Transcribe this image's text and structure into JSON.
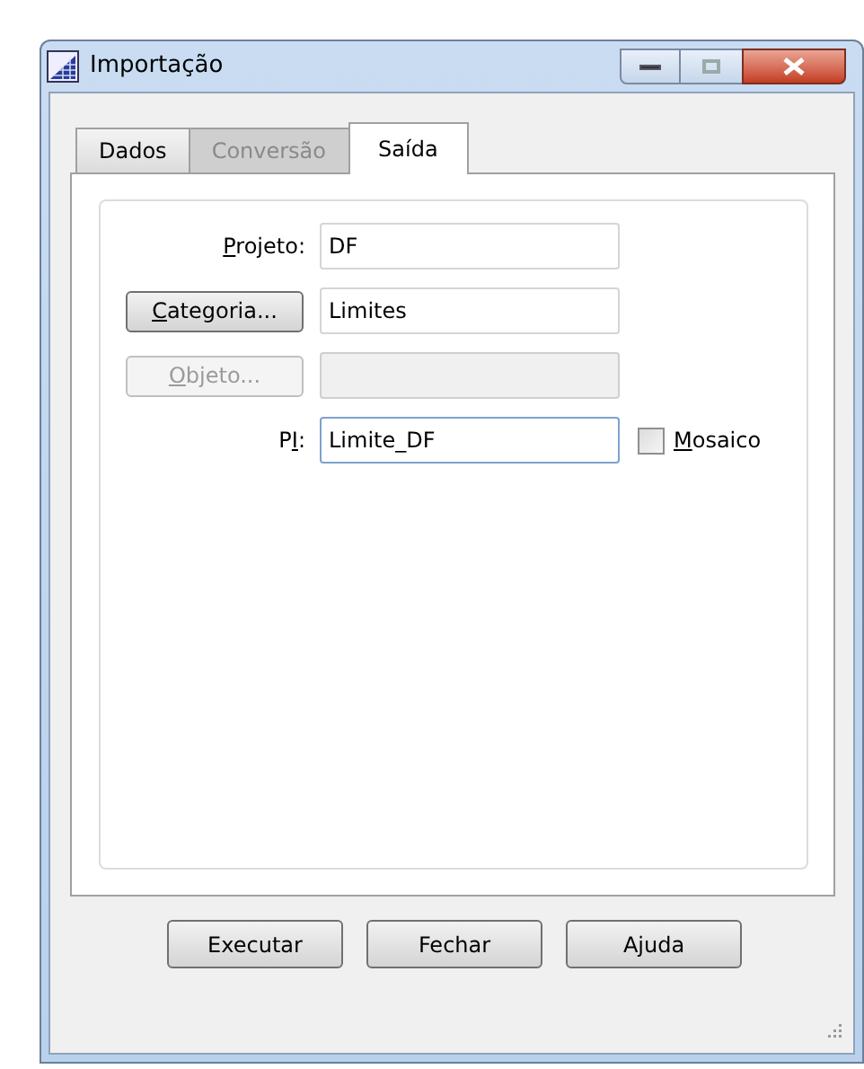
{
  "window": {
    "title": "Importação"
  },
  "tabs": [
    {
      "label": "Dados",
      "selected": false,
      "disabled": false
    },
    {
      "label": "Conversão",
      "selected": false,
      "disabled": true
    },
    {
      "label": "Saída",
      "selected": true,
      "disabled": false
    }
  ],
  "fields": [
    {
      "kind": "label",
      "mnemonic": "P",
      "label_after": "rojeto:",
      "value": "DF",
      "disabled": false,
      "focused": false
    },
    {
      "kind": "button",
      "mnemonic": "C",
      "label_after": "ategoria...",
      "value": "Limites",
      "disabled": false,
      "focused": false
    },
    {
      "kind": "button",
      "mnemonic": "O",
      "label_after": "bjeto...",
      "disabled": true,
      "focused": false
    },
    {
      "kind": "label",
      "label_before": "P",
      "mnemonic": "I",
      "label_after": ":",
      "value": "Limite_DF",
      "disabled": false,
      "focused": true
    }
  ],
  "mosaic": {
    "mnemonic": "M",
    "label_after": "osaico",
    "checked": false
  },
  "buttons": [
    "Executar",
    "Fechar",
    "Ajuda"
  ]
}
